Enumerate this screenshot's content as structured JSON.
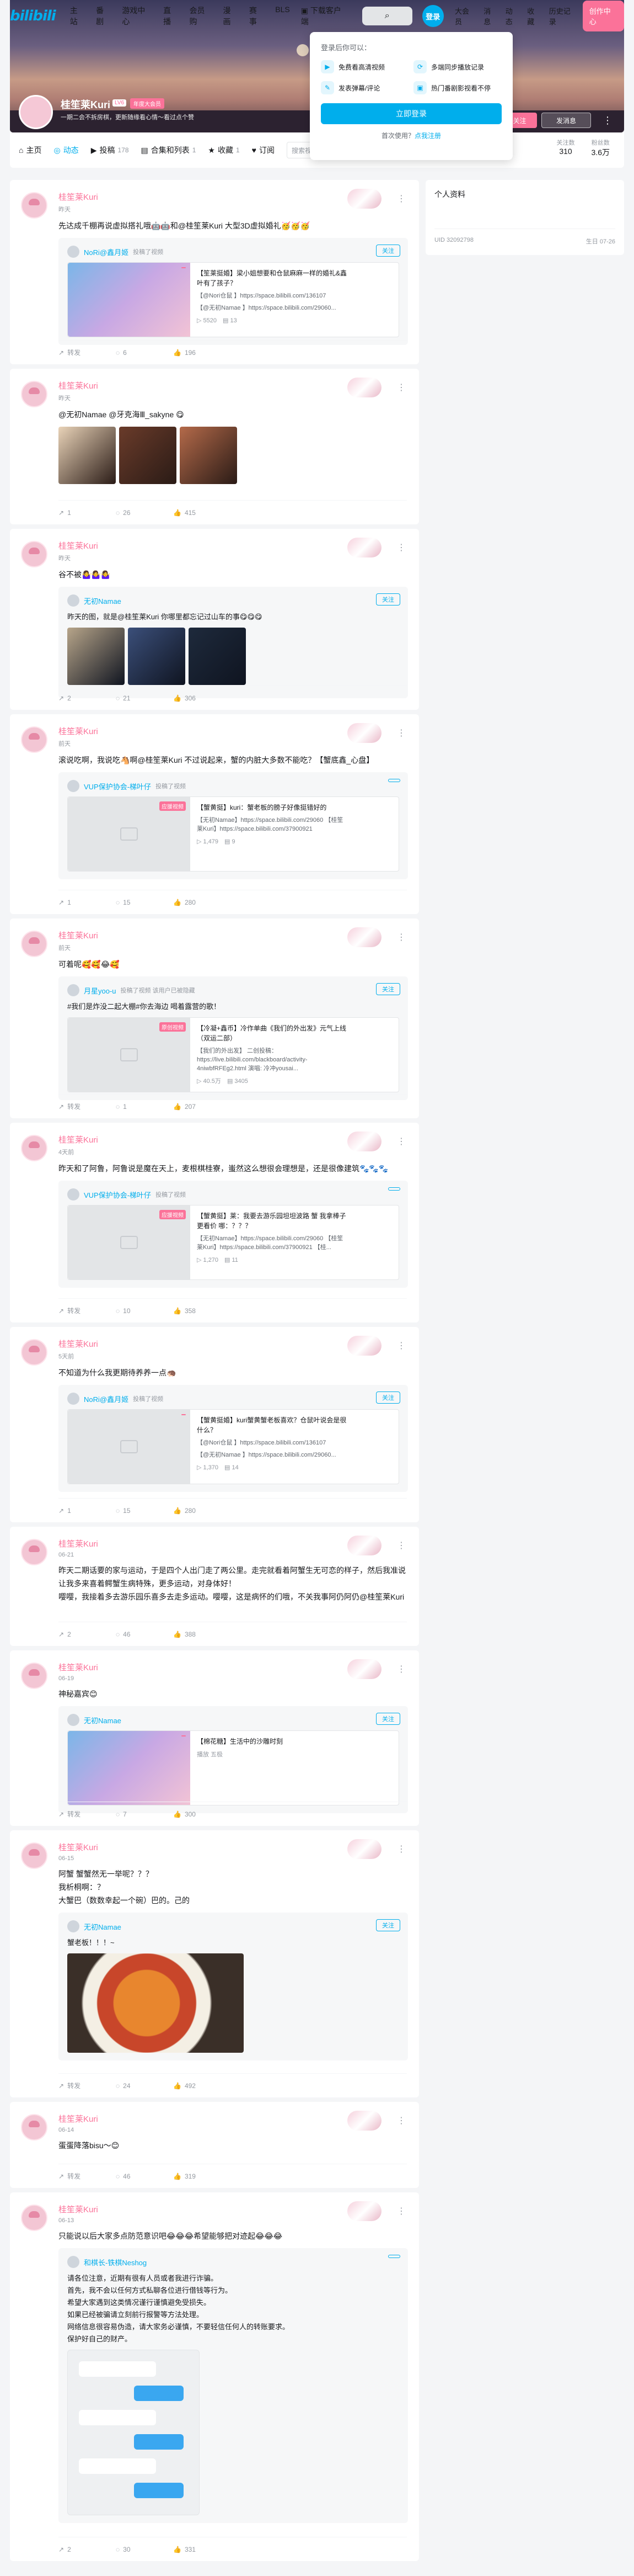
{
  "nav": {
    "logo": "bilibili",
    "left": [
      "主站",
      "番剧",
      "游戏中心",
      "直播",
      "会员购",
      "漫画",
      "赛事",
      "BLS"
    ],
    "download": "下载客户端",
    "search_icon": "search-icon",
    "login": "登录",
    "right": [
      "大会员",
      "消息",
      "动态",
      "收藏",
      "历史记录"
    ],
    "create": "创作中心"
  },
  "user": {
    "name": "桂笙莱Kuri",
    "level": "LV6",
    "vip": "年度大会员",
    "sign": "一期二会不拆房棋，更新随缘看心情～看过点个赞",
    "follow": "+关注",
    "message": "发消息"
  },
  "popup": {
    "title": "登录后你可以：",
    "items": [
      "免费看高清视频",
      "多端同步播放记录",
      "发表弹幕/评论",
      "热门番剧影视看不停"
    ],
    "button": "立即登录",
    "register_prefix": "首次使用？",
    "register_link": "点我注册"
  },
  "tabs": [
    {
      "label": "主页"
    },
    {
      "label": "动态"
    },
    {
      "label": "投稿",
      "count": "178"
    },
    {
      "label": "合集和列表",
      "count": "1"
    },
    {
      "label": "收藏",
      "count": "1"
    },
    {
      "label": "订阅"
    }
  ],
  "tab_search": "搜索视频",
  "stats": [
    {
      "label": "关注数",
      "value": "310"
    },
    {
      "label": "粉丝数",
      "value": "3.6万"
    }
  ],
  "sidebar": {
    "title": "个人资料",
    "uid": "UID 32092798",
    "birthday": "生日 07-26"
  },
  "posts": [
    {
      "name": "桂笙莱Kuri",
      "time": "昨天",
      "text": "先达成千棚再说虚拟搭礼哦🤖🤖和@桂笙莱Kuri 大型3D虚拟婚礼🥳🥳🥳",
      "fwd": {
        "name": "NoRi@鑫月姬",
        "sub": "投稿了视频",
        "follow": "关注",
        "tag": "",
        "title": "【笙莱挺婚】梁小姐想要和仓鼠麻麻一样的婚礼&鑫叶有了孩子？",
        "desc1": "【@Nori仓鼠 】https://space.bilibili.com/136107",
        "desc2": "【@无初Namae 】https://space.bilibili.com/29060...",
        "views": "5520",
        "danmu": "13"
      },
      "acts": [
        "转发",
        "6",
        "196"
      ]
    },
    {
      "name": "桂笙莱Kuri",
      "time": "昨天",
      "text": "@无初Namae @牙克海Ⅲ_sakyne 😋",
      "acts": [
        "1",
        "26",
        "415"
      ]
    },
    {
      "name": "桂笙莱Kuri",
      "time": "昨天",
      "text": "谷不被🤷‍♀️🤷‍♀️🤷‍♀️",
      "fwd": {
        "name": "无初Namae",
        "sub": "",
        "follow": "关注",
        "text": "昨天的图，就是@桂笙莱Kuri 你哪里都忘记过山车的事😋😋😋"
      },
      "acts": [
        "2",
        "21",
        "306"
      ]
    },
    {
      "name": "桂笙莱Kuri",
      "time": "前天",
      "text": "滚说吃啊，我说吃🐴啊@桂笙莱Kuri 不过说起来，蟹的内脏大多数不能吃？【蟹底鑫_心盘】",
      "fwd": {
        "name": "VUP保护协会-梯叶仔",
        "sub": "投稿了视频",
        "follow": "",
        "tag": "应援视频",
        "title": "【蟹黄挺】kuri：蟹老板的膀子好像挺错好的",
        "desc1": "【无初Namae】https://space.bilibili.com/29060 【桂笙莱Kuri】https://space.bilibili.com/37900921",
        "desc2": "",
        "views": "1,479",
        "danmu": "9"
      },
      "acts": [
        "1",
        "15",
        "280"
      ]
    },
    {
      "name": "桂笙莱Kuri",
      "time": "前天",
      "text": "可着呢🥰🥰😂🥰",
      "fwd": {
        "name": "月星yoo-u",
        "sub": "投稿了视频 该用户已被隐藏",
        "follow": "关注",
        "text": "#我们是炸没二起大棚#你去海边 喝着露营的歌！",
        "tag": "原创视频",
        "title": "【冷凝+鑫币】冷作单曲《我们的外出发》元气上线（双运二部）",
        "desc1": "【我们的外出发】 二创投稿：https://live.bilibili.com/blackboard/activity-4niwbfRFEg2.html 演唱: 冷冲yousai...",
        "desc2": "",
        "views": "40.5万",
        "danmu": "3405"
      },
      "acts": [
        "转发",
        "1",
        "207"
      ]
    },
    {
      "name": "桂笙莱Kuri",
      "time": "4天前",
      "text": "昨天和了阿鲁，阿鲁说是魔在天上，麦根棋桂寮，蚩然这么想很会理想是，还是很像建筑🐾🐾🐾",
      "fwd": {
        "name": "VUP保护协会-梯叶仔",
        "sub": "投稿了视频",
        "follow": "",
        "tag": "应援视频",
        "title": "【蟹黄挺】莱：我要去游乐园坦坦波路 蟹 我拿棒子更看价 哪：？？？",
        "desc1": "【无初Namae】https://space.bilibili.com/29060 【桂笙莱Kuri】https://space.bilibili.com/37900921 【桂...",
        "desc2": "",
        "views": "1,270",
        "danmu": "11"
      },
      "acts": [
        "转发",
        "10",
        "358"
      ]
    },
    {
      "name": "桂笙莱Kuri",
      "time": "5天前",
      "text": "不知道为什么我更期待养养一点🦔",
      "fwd": {
        "name": "NoRi@鑫月姬",
        "sub": "投稿了视频",
        "follow": "关注",
        "tag": "",
        "title": "【蟹黄挺婚】kuri蟹黄蟹老板喜欢？仓鼠叶说会是很什么？",
        "desc1": "【@Nori仓鼠 】https://space.bilibili.com/136107",
        "desc2": "【@无初Namae 】https://space.bilibili.com/29060...",
        "views": "1,370",
        "danmu": "14"
      },
      "acts": [
        "1",
        "15",
        "280"
      ]
    },
    {
      "name": "桂笙莱Kuri",
      "time": "06-21",
      "text": "昨天二期话要的家与运动，于是四个人出门走了两公里。走完就看着阿蟹生无可恋的样子，然后我准说让我多来喜着鳄蟹生病特殊，更多运动，对身体好！\n嘤嘤，我接着多去游乐园乐喜多去走多运动。嘤嘤，这是病怀的们哦，不关我事阿仍阿仍@桂笙莱Kuri",
      "acts": [
        "2",
        "46",
        "388"
      ]
    },
    {
      "name": "桂笙莱Kuri",
      "time": "06-19",
      "text": "神秘嘉宾😊",
      "fwd": {
        "name": "无初Namae",
        "sub": "",
        "follow": "关注",
        "tag": "",
        "title": "【棉花糖】生活中的沙雕时刻",
        "desc1": "",
        "desc2": "",
        "stat": "播放 五极",
        "thumb": "color"
      },
      "acts": [
        "转发",
        "7",
        "300"
      ]
    },
    {
      "name": "桂笙莱Kuri",
      "time": "06-15",
      "text": "阿蟹 蟹蟹然无一举呢？？？\n我析桐啊：？\n大蟹巴（数数幸起一个碗）巴的。己的",
      "fwd": {
        "name": "无初Namae",
        "sub": "",
        "follow": "关注",
        "text": "蟹老板！！！~"
      },
      "acts": [
        "转发",
        "24",
        "492"
      ]
    },
    {
      "name": "桂笙莱Kuri",
      "time": "06-14",
      "text": "蛋蛋降落bisu～😊",
      "acts": [
        "转发",
        "46",
        "319"
      ]
    },
    {
      "name": "桂笙莱Kuri",
      "time": "06-13",
      "text": "只能说以后大家多点防范意识吧😂😂😂希望能够把对迹起😂😂😂",
      "fwd": {
        "name": "和棋长-铁棋Neshog",
        "sub": "",
        "follow": "",
        "text": "请各位注意，近期有很有人员或者我进行诈骗。\n首先，我不会以任何方式私聊各位进行借钱等行为。\n希望大家遇到这类情况谨行谨慎避免受损失。\n如果已经被骗请立刻前行报警等方法处理。\n网络信息很容易伪造，请大家务必谨慎，不要轻信任何人的转账要求。\n保护好自己的财产。"
      },
      "acts": [
        "2",
        "30",
        "331"
      ]
    }
  ]
}
